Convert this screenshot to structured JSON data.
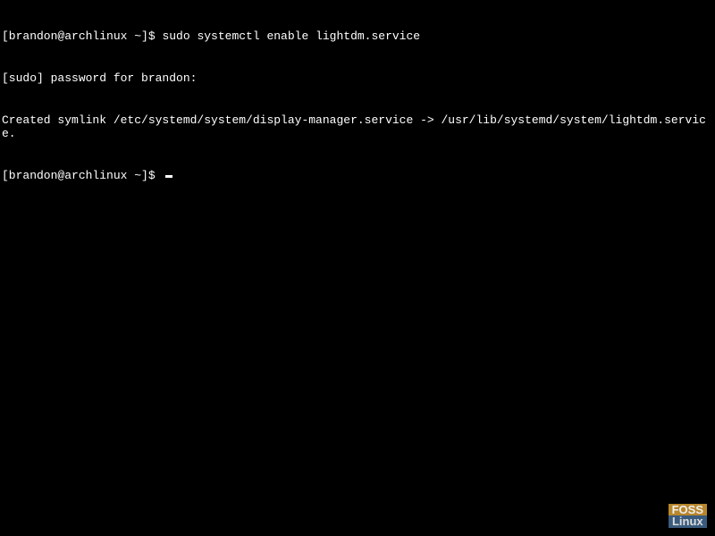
{
  "terminal": {
    "line1_prompt": "[brandon@archlinux ~]$ ",
    "line1_command": "sudo systemctl enable lightdm.service",
    "line2": "[sudo] password for brandon:",
    "line3": "Created symlink /etc/systemd/system/display-manager.service -> /usr/lib/systemd/system/lightdm.service.",
    "line4_prompt": "[brandon@archlinux ~]$ "
  },
  "watermark": {
    "top": "FOSS",
    "bottom": "Linux"
  }
}
